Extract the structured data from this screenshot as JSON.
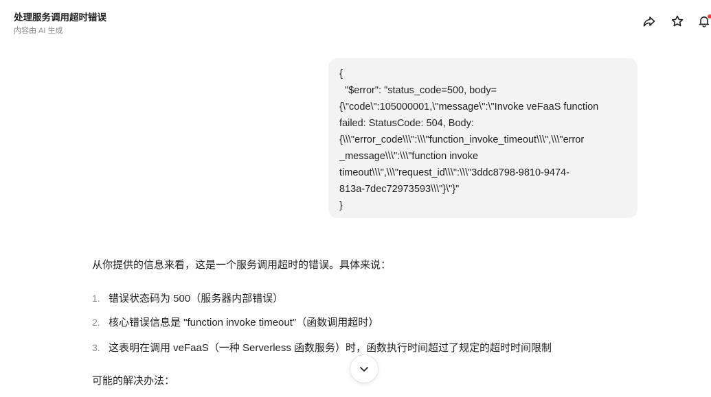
{
  "header": {
    "title": "处理服务调用超时错误",
    "subtitle": "内容由 AI 生成",
    "icons": [
      "share-icon",
      "star-icon",
      "bell-icon"
    ]
  },
  "user_message": {
    "lines": [
      "{",
      "  \"$error\": \"status_code=500, body=",
      "{\\\"code\\\":105000001,\\\"message\\\":\\\"Invoke veFaaS function",
      "failed: StatusCode: 504, Body:",
      "{\\\\\\\"error_code\\\\\\\":\\\\\\\"function_invoke_timeout\\\\\\\",\\\\\\\"error",
      "_message\\\\\\\":\\\\\\\"function invoke",
      "timeout\\\\\\\",\\\\\\\"request_id\\\\\\\":\\\\\\\"3ddc8798-9810-9474-",
      "813a-7dec72973593\\\\\\\"}\\\"}\"",
      "}"
    ]
  },
  "answer": {
    "intro": "从你提供的信息来看，这是一个服务调用超时的错误。具体来说：",
    "items": [
      {
        "num": "1.",
        "text": "错误状态码为 500（服务器内部错误）"
      },
      {
        "num": "2.",
        "text": "核心错误信息是 \"function invoke timeout\"（函数调用超时）"
      },
      {
        "num": "3.",
        "text": "这表明在调用 veFaaS（一种 Serverless 函数服务）时，函数执行时间超过了规定的超时时间限制"
      }
    ],
    "solutions_heading": "可能的解决办法："
  },
  "colors": {
    "bubble_bg": "#f3f3f3",
    "notification_dot": "#f53f3f",
    "muted_text": "#8a8a8a"
  }
}
